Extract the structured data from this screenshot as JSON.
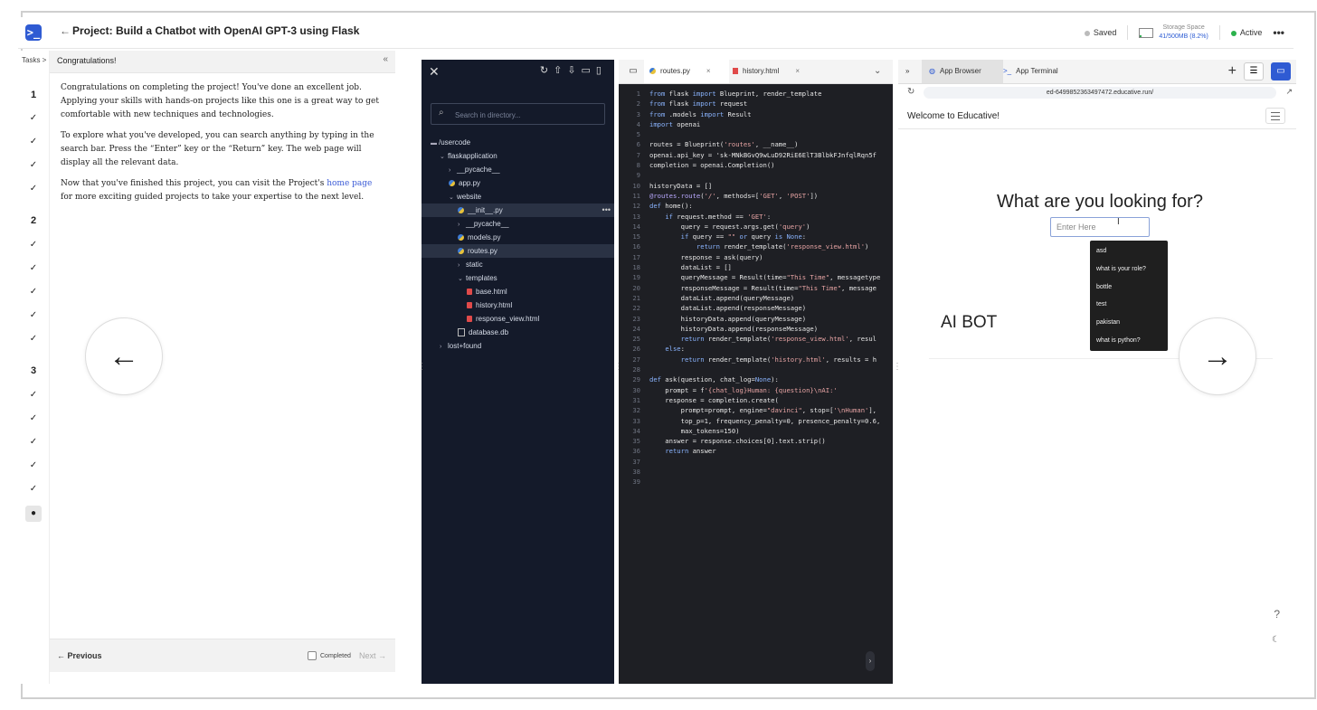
{
  "topbar": {
    "title": "Project: Build a Chatbot with OpenAI GPT-3 using Flask",
    "saved": "Saved",
    "storage_label": "Storage Space",
    "storage_value": "41/500MB (8.2%)",
    "storage_fraction": 0.082,
    "status": "Active",
    "more": "•••"
  },
  "rail": {
    "label": "Tasks >",
    "sections": [
      "1",
      "2",
      "3"
    ],
    "check": "✓",
    "current": "●"
  },
  "lesson": {
    "header": "Congratulations!",
    "collapse": "«",
    "p1": "Congratulations on completing the project! You've done an excellent job. Applying your skills with hands-on projects like this one is a great way to get comfortable with new techniques and technologies.",
    "p2": "To explore what you've developed, you can search anything by typing in the search bar. Press the “Enter” key or the “Return” key. The web page will display all the relevant data.",
    "p3_before": "Now that you've finished this project, you can visit the Project's ",
    "p3_link": "home page",
    "p3_after": " for more exciting guided projects to take your expertise to the next level.",
    "previous": "← Previous",
    "completed": "Completed",
    "next": "Next →"
  },
  "explorer": {
    "close": "✕",
    "tools": "↻⇧⇩▭▯",
    "search_placeholder": "Search in directory...",
    "tree": [
      {
        "label": "/usercode",
        "depth": 0,
        "kind": "folder-open"
      },
      {
        "label": "flaskapplication",
        "depth": 1,
        "kind": "chev-down"
      },
      {
        "label": "__pycache__",
        "depth": 2,
        "kind": "chev-right"
      },
      {
        "label": "app.py",
        "depth": 2,
        "kind": "py"
      },
      {
        "label": "website",
        "depth": 2,
        "kind": "chev-down"
      },
      {
        "label": "__init__.py",
        "depth": 3,
        "kind": "py",
        "sel": true
      },
      {
        "label": "__pycache__",
        "depth": 3,
        "kind": "chev-right"
      },
      {
        "label": "models.py",
        "depth": 3,
        "kind": "py"
      },
      {
        "label": "routes.py",
        "depth": 3,
        "kind": "py",
        "sel": true
      },
      {
        "label": "static",
        "depth": 3,
        "kind": "chev-right"
      },
      {
        "label": "templates",
        "depth": 3,
        "kind": "chev-down"
      },
      {
        "label": "base.html",
        "depth": 4,
        "kind": "html"
      },
      {
        "label": "history.html",
        "depth": 4,
        "kind": "html"
      },
      {
        "label": "response_view.html",
        "depth": 4,
        "kind": "html"
      },
      {
        "label": "database.db",
        "depth": 3,
        "kind": "db"
      },
      {
        "label": "lost+found",
        "depth": 1,
        "kind": "chev-right"
      }
    ]
  },
  "editor": {
    "tab1": "routes.py",
    "tab2": "history.html",
    "close": "×",
    "lines": [
      "from flask import Blueprint, render_template",
      "from flask import request",
      "from .models import Result",
      "import openai",
      "",
      "routes = Blueprint('routes', __name__)",
      "openai.api_key = 'sk-MNkBGvQ9wLuD92RiE6ElT3BlbkFJnfqlRqn5f",
      "completion = openai.Completion()",
      "",
      "historyData = []",
      "@routes.route('/', methods=['GET', 'POST'])",
      "def home():",
      "    if request.method == 'GET':",
      "        query = request.args.get('query')",
      "        if query == \"\" or query is None:",
      "            return render_template('response_view.html')",
      "        response = ask(query)",
      "        dataList = []",
      "        queryMessage = Result(time=\"This Time\", messagetype",
      "        responseMessage = Result(time=\"This Time\", message",
      "        dataList.append(queryMessage)",
      "        dataList.append(responseMessage)",
      "        historyData.append(queryMessage)",
      "        historyData.append(responseMessage)",
      "        return render_template('response_view.html', resul",
      "    else:",
      "        return render_template('history.html', results = h",
      "",
      "def ask(question, chat_log=None):",
      "    prompt = f'{chat_log}Human: {question}\\nAI:'",
      "    response = completion.create(",
      "        prompt=prompt, engine=\"davinci\", stop=['\\nHuman'],",
      "        top_p=1, frequency_penalty=0, presence_penalty=0.6,",
      "        max_tokens=150)",
      "    answer = response.choices[0].text.strip()",
      "    return answer",
      "",
      "",
      ""
    ]
  },
  "browser": {
    "tab1": "App Browser",
    "tab2": "App Terminal",
    "expand": "»",
    "url": "ed-6499852363497472.educative.run/",
    "welcome": "Welcome to Educative!",
    "heading": "What are you looking for?",
    "input_placeholder": "Enter Here",
    "options": [
      "asd",
      "what is your role?",
      "bottle",
      "test",
      "pakistan",
      "what is python?"
    ],
    "aibot": "AI BOT",
    "help": "?",
    "plus": "+"
  },
  "colors": {
    "accent": "#2f5bd3",
    "explorer_bg": "#141a2a",
    "editor_bg": "#1e1f24"
  }
}
